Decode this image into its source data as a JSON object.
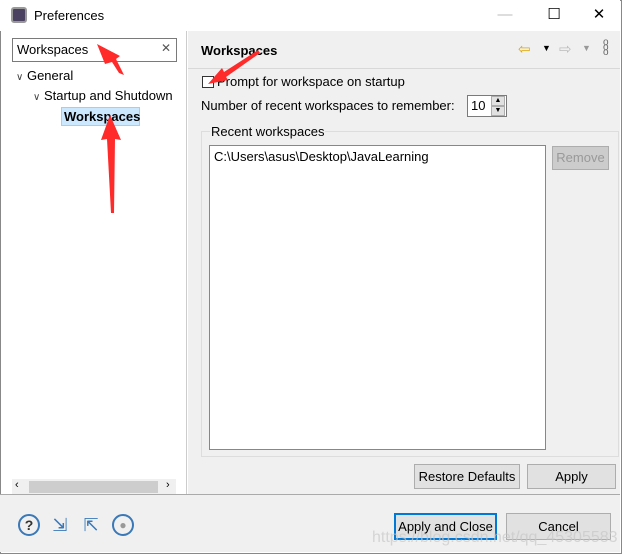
{
  "window": {
    "title": "Preferences",
    "minimize": "—",
    "maximize": "☐",
    "close": "✕"
  },
  "filter": {
    "value": "Workspaces",
    "clear": "✕"
  },
  "tree": [
    {
      "label": "General",
      "expanded": true
    },
    {
      "label": "Startup and Shutdown",
      "expanded": true
    },
    {
      "label": "Workspaces",
      "selected": true
    }
  ],
  "page": {
    "title": "Workspaces",
    "prompt_label": "Prompt for workspace on startup",
    "prompt_checked": false,
    "recent_label": "Number of recent workspaces to remember:",
    "recent_value": "10",
    "group_label": "Recent workspaces",
    "workspaces": [
      "C:\\Users\\asus\\Desktop\\JavaLearning"
    ],
    "remove": "Remove",
    "restore_defaults": "Restore Defaults",
    "apply": "Apply"
  },
  "footer": {
    "apply_close": "Apply and Close",
    "cancel": "Cancel"
  },
  "watermark": "https://blog.csdn.net/qq_45305583",
  "colors": {
    "selection": "#cce8ff",
    "annotation": "#ff2a2a",
    "focus": "#0078d7"
  }
}
